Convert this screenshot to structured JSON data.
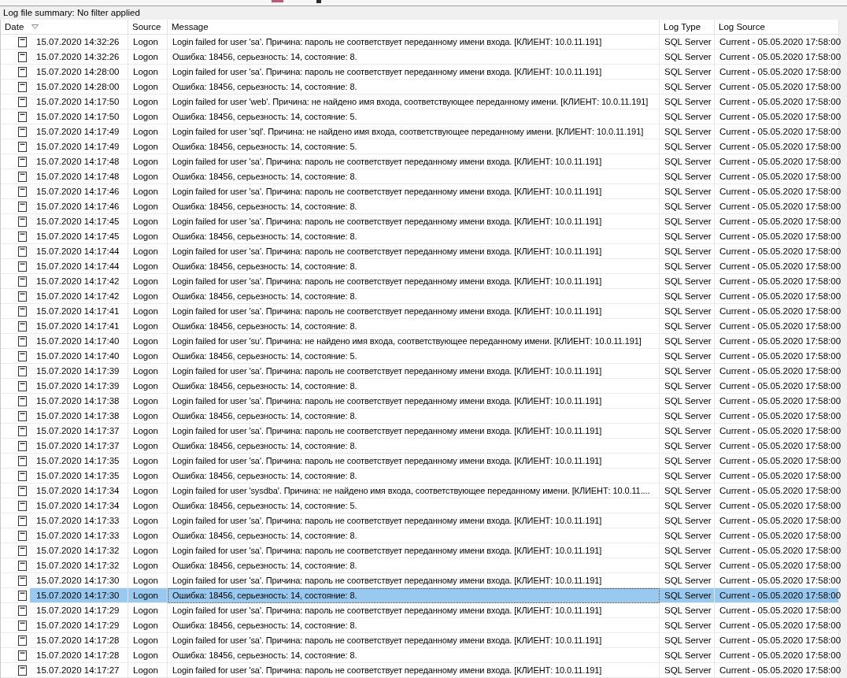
{
  "summary": "Log file summary: No filter applied",
  "columns": [
    {
      "label": "Date",
      "sorted": true
    },
    {
      "label": "Source",
      "sorted": false
    },
    {
      "label": "Message",
      "sorted": false
    },
    {
      "label": "Log Type",
      "sorted": false
    },
    {
      "label": "Log Source",
      "sorted": false
    }
  ],
  "rows": [
    {
      "date": "15.07.2020 14:32:26",
      "source": "Logon",
      "message": "Login failed for user 'sa'. Причина: пароль не соответствует переданному имени входа. [КЛИЕНТ: 10.0.11.191]",
      "log_type": "SQL Server",
      "log_source": "Current - 05.05.2020 17:58:00",
      "selected": false
    },
    {
      "date": "15.07.2020 14:32:26",
      "source": "Logon",
      "message": "Ошибка: 18456, серьезность: 14, состояние: 8.",
      "log_type": "SQL Server",
      "log_source": "Current - 05.05.2020 17:58:00",
      "selected": false
    },
    {
      "date": "15.07.2020 14:28:00",
      "source": "Logon",
      "message": "Login failed for user 'sa'. Причина: пароль не соответствует переданному имени входа. [КЛИЕНТ: 10.0.11.191]",
      "log_type": "SQL Server",
      "log_source": "Current - 05.05.2020 17:58:00",
      "selected": false
    },
    {
      "date": "15.07.2020 14:28:00",
      "source": "Logon",
      "message": "Ошибка: 18456, серьезность: 14, состояние: 8.",
      "log_type": "SQL Server",
      "log_source": "Current - 05.05.2020 17:58:00",
      "selected": false
    },
    {
      "date": "15.07.2020 14:17:50",
      "source": "Logon",
      "message": "Login failed for user 'web'. Причина: не найдено имя входа, соответствующее переданному имени. [КЛИЕНТ: 10.0.11.191]",
      "log_type": "SQL Server",
      "log_source": "Current - 05.05.2020 17:58:00",
      "selected": false
    },
    {
      "date": "15.07.2020 14:17:50",
      "source": "Logon",
      "message": "Ошибка: 18456, серьезность: 14, состояние: 5.",
      "log_type": "SQL Server",
      "log_source": "Current - 05.05.2020 17:58:00",
      "selected": false
    },
    {
      "date": "15.07.2020 14:17:49",
      "source": "Logon",
      "message": "Login failed for user 'sql'. Причина: не найдено имя входа, соответствующее переданному имени. [КЛИЕНТ: 10.0.11.191]",
      "log_type": "SQL Server",
      "log_source": "Current - 05.05.2020 17:58:00",
      "selected": false
    },
    {
      "date": "15.07.2020 14:17:49",
      "source": "Logon",
      "message": "Ошибка: 18456, серьезность: 14, состояние: 5.",
      "log_type": "SQL Server",
      "log_source": "Current - 05.05.2020 17:58:00",
      "selected": false
    },
    {
      "date": "15.07.2020 14:17:48",
      "source": "Logon",
      "message": "Login failed for user 'sa'. Причина: пароль не соответствует переданному имени входа. [КЛИЕНТ: 10.0.11.191]",
      "log_type": "SQL Server",
      "log_source": "Current - 05.05.2020 17:58:00",
      "selected": false
    },
    {
      "date": "15.07.2020 14:17:48",
      "source": "Logon",
      "message": "Ошибка: 18456, серьезность: 14, состояние: 8.",
      "log_type": "SQL Server",
      "log_source": "Current - 05.05.2020 17:58:00",
      "selected": false
    },
    {
      "date": "15.07.2020 14:17:46",
      "source": "Logon",
      "message": "Login failed for user 'sa'. Причина: пароль не соответствует переданному имени входа. [КЛИЕНТ: 10.0.11.191]",
      "log_type": "SQL Server",
      "log_source": "Current - 05.05.2020 17:58:00",
      "selected": false
    },
    {
      "date": "15.07.2020 14:17:46",
      "source": "Logon",
      "message": "Ошибка: 18456, серьезность: 14, состояние: 8.",
      "log_type": "SQL Server",
      "log_source": "Current - 05.05.2020 17:58:00",
      "selected": false
    },
    {
      "date": "15.07.2020 14:17:45",
      "source": "Logon",
      "message": "Login failed for user 'sa'. Причина: пароль не соответствует переданному имени входа. [КЛИЕНТ: 10.0.11.191]",
      "log_type": "SQL Server",
      "log_source": "Current - 05.05.2020 17:58:00",
      "selected": false
    },
    {
      "date": "15.07.2020 14:17:45",
      "source": "Logon",
      "message": "Ошибка: 18456, серьезность: 14, состояние: 8.",
      "log_type": "SQL Server",
      "log_source": "Current - 05.05.2020 17:58:00",
      "selected": false
    },
    {
      "date": "15.07.2020 14:17:44",
      "source": "Logon",
      "message": "Login failed for user 'sa'. Причина: пароль не соответствует переданному имени входа. [КЛИЕНТ: 10.0.11.191]",
      "log_type": "SQL Server",
      "log_source": "Current - 05.05.2020 17:58:00",
      "selected": false
    },
    {
      "date": "15.07.2020 14:17:44",
      "source": "Logon",
      "message": "Ошибка: 18456, серьезность: 14, состояние: 8.",
      "log_type": "SQL Server",
      "log_source": "Current - 05.05.2020 17:58:00",
      "selected": false
    },
    {
      "date": "15.07.2020 14:17:42",
      "source": "Logon",
      "message": "Login failed for user 'sa'. Причина: пароль не соответствует переданному имени входа. [КЛИЕНТ: 10.0.11.191]",
      "log_type": "SQL Server",
      "log_source": "Current - 05.05.2020 17:58:00",
      "selected": false
    },
    {
      "date": "15.07.2020 14:17:42",
      "source": "Logon",
      "message": "Ошибка: 18456, серьезность: 14, состояние: 8.",
      "log_type": "SQL Server",
      "log_source": "Current - 05.05.2020 17:58:00",
      "selected": false
    },
    {
      "date": "15.07.2020 14:17:41",
      "source": "Logon",
      "message": "Login failed for user 'sa'. Причина: пароль не соответствует переданному имени входа. [КЛИЕНТ: 10.0.11.191]",
      "log_type": "SQL Server",
      "log_source": "Current - 05.05.2020 17:58:00",
      "selected": false
    },
    {
      "date": "15.07.2020 14:17:41",
      "source": "Logon",
      "message": "Ошибка: 18456, серьезность: 14, состояние: 8.",
      "log_type": "SQL Server",
      "log_source": "Current - 05.05.2020 17:58:00",
      "selected": false
    },
    {
      "date": "15.07.2020 14:17:40",
      "source": "Logon",
      "message": "Login failed for user 'su'. Причина: не найдено имя входа, соответствующее переданному имени. [КЛИЕНТ: 10.0.11.191]",
      "log_type": "SQL Server",
      "log_source": "Current - 05.05.2020 17:58:00",
      "selected": false
    },
    {
      "date": "15.07.2020 14:17:40",
      "source": "Logon",
      "message": "Ошибка: 18456, серьезность: 14, состояние: 5.",
      "log_type": "SQL Server",
      "log_source": "Current - 05.05.2020 17:58:00",
      "selected": false
    },
    {
      "date": "15.07.2020 14:17:39",
      "source": "Logon",
      "message": "Login failed for user 'sa'. Причина: пароль не соответствует переданному имени входа. [КЛИЕНТ: 10.0.11.191]",
      "log_type": "SQL Server",
      "log_source": "Current - 05.05.2020 17:58:00",
      "selected": false
    },
    {
      "date": "15.07.2020 14:17:39",
      "source": "Logon",
      "message": "Ошибка: 18456, серьезность: 14, состояние: 8.",
      "log_type": "SQL Server",
      "log_source": "Current - 05.05.2020 17:58:00",
      "selected": false
    },
    {
      "date": "15.07.2020 14:17:38",
      "source": "Logon",
      "message": "Login failed for user 'sa'. Причина: пароль не соответствует переданному имени входа. [КЛИЕНТ: 10.0.11.191]",
      "log_type": "SQL Server",
      "log_source": "Current - 05.05.2020 17:58:00",
      "selected": false
    },
    {
      "date": "15.07.2020 14:17:38",
      "source": "Logon",
      "message": "Ошибка: 18456, серьезность: 14, состояние: 8.",
      "log_type": "SQL Server",
      "log_source": "Current - 05.05.2020 17:58:00",
      "selected": false
    },
    {
      "date": "15.07.2020 14:17:37",
      "source": "Logon",
      "message": "Login failed for user 'sa'. Причина: пароль не соответствует переданному имени входа. [КЛИЕНТ: 10.0.11.191]",
      "log_type": "SQL Server",
      "log_source": "Current - 05.05.2020 17:58:00",
      "selected": false
    },
    {
      "date": "15.07.2020 14:17:37",
      "source": "Logon",
      "message": "Ошибка: 18456, серьезность: 14, состояние: 8.",
      "log_type": "SQL Server",
      "log_source": "Current - 05.05.2020 17:58:00",
      "selected": false
    },
    {
      "date": "15.07.2020 14:17:35",
      "source": "Logon",
      "message": "Login failed for user 'sa'. Причина: пароль не соответствует переданному имени входа. [КЛИЕНТ: 10.0.11.191]",
      "log_type": "SQL Server",
      "log_source": "Current - 05.05.2020 17:58:00",
      "selected": false
    },
    {
      "date": "15.07.2020 14:17:35",
      "source": "Logon",
      "message": "Ошибка: 18456, серьезность: 14, состояние: 8.",
      "log_type": "SQL Server",
      "log_source": "Current - 05.05.2020 17:58:00",
      "selected": false
    },
    {
      "date": "15.07.2020 14:17:34",
      "source": "Logon",
      "message": "Login failed for user 'sysdba'. Причина: не найдено имя входа, соответствующее переданному имени. [КЛИЕНТ: 10.0.11....",
      "log_type": "SQL Server",
      "log_source": "Current - 05.05.2020 17:58:00",
      "selected": false
    },
    {
      "date": "15.07.2020 14:17:34",
      "source": "Logon",
      "message": "Ошибка: 18456, серьезность: 14, состояние: 5.",
      "log_type": "SQL Server",
      "log_source": "Current - 05.05.2020 17:58:00",
      "selected": false
    },
    {
      "date": "15.07.2020 14:17:33",
      "source": "Logon",
      "message": "Login failed for user 'sa'. Причина: пароль не соответствует переданному имени входа. [КЛИЕНТ: 10.0.11.191]",
      "log_type": "SQL Server",
      "log_source": "Current - 05.05.2020 17:58:00",
      "selected": false
    },
    {
      "date": "15.07.2020 14:17:33",
      "source": "Logon",
      "message": "Ошибка: 18456, серьезность: 14, состояние: 8.",
      "log_type": "SQL Server",
      "log_source": "Current - 05.05.2020 17:58:00",
      "selected": false
    },
    {
      "date": "15.07.2020 14:17:32",
      "source": "Logon",
      "message": "Login failed for user 'sa'. Причина: пароль не соответствует переданному имени входа. [КЛИЕНТ: 10.0.11.191]",
      "log_type": "SQL Server",
      "log_source": "Current - 05.05.2020 17:58:00",
      "selected": false
    },
    {
      "date": "15.07.2020 14:17:32",
      "source": "Logon",
      "message": "Ошибка: 18456, серьезность: 14, состояние: 8.",
      "log_type": "SQL Server",
      "log_source": "Current - 05.05.2020 17:58:00",
      "selected": false
    },
    {
      "date": "15.07.2020 14:17:30",
      "source": "Logon",
      "message": "Login failed for user 'sa'. Причина: пароль не соответствует переданному имени входа. [КЛИЕНТ: 10.0.11.191]",
      "log_type": "SQL Server",
      "log_source": "Current - 05.05.2020 17:58:00",
      "selected": false
    },
    {
      "date": "15.07.2020 14:17:30",
      "source": "Logon",
      "message": "Ошибка: 18456, серьезность: 14, состояние: 8.",
      "log_type": "SQL Server",
      "log_source": "Current - 05.05.2020 17:58:00",
      "selected": true
    },
    {
      "date": "15.07.2020 14:17:29",
      "source": "Logon",
      "message": "Login failed for user 'sa'. Причина: пароль не соответствует переданному имени входа. [КЛИЕНТ: 10.0.11.191]",
      "log_type": "SQL Server",
      "log_source": "Current - 05.05.2020 17:58:00",
      "selected": false
    },
    {
      "date": "15.07.2020 14:17:29",
      "source": "Logon",
      "message": "Ошибка: 18456, серьезность: 14, состояние: 8.",
      "log_type": "SQL Server",
      "log_source": "Current - 05.05.2020 17:58:00",
      "selected": false
    },
    {
      "date": "15.07.2020 14:17:28",
      "source": "Logon",
      "message": "Login failed for user 'sa'. Причина: пароль не соответствует переданному имени входа. [КЛИЕНТ: 10.0.11.191]",
      "log_type": "SQL Server",
      "log_source": "Current - 05.05.2020 17:58:00",
      "selected": false
    },
    {
      "date": "15.07.2020 14:17:28",
      "source": "Logon",
      "message": "Ошибка: 18456, серьезность: 14, состояние: 8.",
      "log_type": "SQL Server",
      "log_source": "Current - 05.05.2020 17:58:00",
      "selected": false
    },
    {
      "date": "15.07.2020 14:17:27",
      "source": "Logon",
      "message": "Login failed for user 'sa'. Причина: пароль не соответствует переданному имени входа. [КЛИЕНТ: 10.0.11.191]",
      "log_type": "SQL Server",
      "log_source": "Current - 05.05.2020 17:58:00",
      "selected": false
    }
  ]
}
